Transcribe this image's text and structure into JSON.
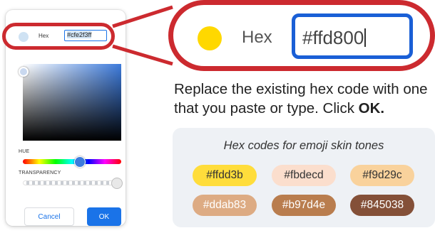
{
  "picker": {
    "hex_label": "Hex",
    "hex_value": "#cfe2f3ff",
    "swatch_color": "#cfe2f3",
    "hue_label": "HUE",
    "transparency_label": "TRANSPARENCY",
    "cancel_label": "Cancel",
    "ok_label": "OK"
  },
  "zoom": {
    "hex_label": "Hex",
    "hex_value": "#ffd800",
    "swatch_color": "#ffd800"
  },
  "instruction": {
    "text": "Replace the existing hex code with one that you paste or type. Click ",
    "emphasis": "OK."
  },
  "skin_tones": {
    "title": "Hex codes for emoji skin tones",
    "chips": [
      {
        "label": "#ffdd3b",
        "bg": "#ffdd3b",
        "fg": "#333333"
      },
      {
        "label": "#fbdecd",
        "bg": "#fbdecd",
        "fg": "#333333"
      },
      {
        "label": "#f9d29c",
        "bg": "#f9d29c",
        "fg": "#333333"
      },
      {
        "label": "#ddab83",
        "bg": "#ddab83",
        "fg": "#ffffff"
      },
      {
        "label": "#b97d4e",
        "bg": "#b97d4e",
        "fg": "#ffffff"
      },
      {
        "label": "#845038",
        "bg": "#845038",
        "fg": "#ffffff"
      }
    ]
  },
  "colors": {
    "highlight": "#cc2a2f",
    "accent": "#1a73e8"
  }
}
